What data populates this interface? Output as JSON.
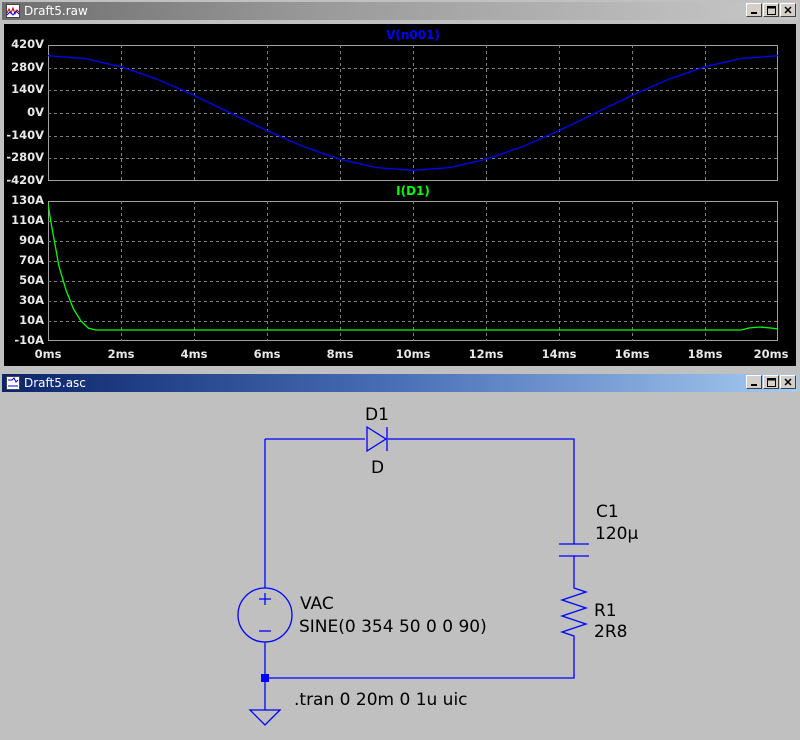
{
  "waveform_window": {
    "title": "Draft5.raw",
    "buttons": {
      "minimize": "_",
      "maximize": "□",
      "close": "×"
    }
  },
  "schematic_window": {
    "title": "Draft5.asc",
    "buttons": {
      "minimize": "_",
      "maximize": "□",
      "close": "×"
    }
  },
  "colors": {
    "voltage_trace": "#0000ff",
    "current_trace": "#00ff00",
    "plot_background": "#000000",
    "grid": "#808080",
    "wire": "#0000ff"
  },
  "chart_data": [
    {
      "type": "line",
      "title": "V(n001)",
      "x_unit": "ms",
      "x_range": [
        0,
        20
      ],
      "x_ticks": [
        "0ms",
        "2ms",
        "4ms",
        "6ms",
        "8ms",
        "10ms",
        "12ms",
        "14ms",
        "16ms",
        "18ms",
        "20ms"
      ],
      "y_range": [
        -420,
        420
      ],
      "y_ticks": [
        "420V",
        "280V",
        "140V",
        "0V",
        "-140V",
        "-280V",
        "-420V"
      ],
      "grid": true,
      "series": [
        {
          "name": "V(n001)",
          "color": "#0000ff",
          "x": [
            0,
            1,
            2,
            3,
            4,
            5,
            6,
            7,
            8,
            9,
            10,
            11,
            12,
            13,
            14,
            15,
            16,
            17,
            18,
            19,
            20
          ],
          "y": [
            354,
            337,
            286,
            208,
            109,
            0,
            -109,
            -208,
            -286,
            -337,
            -354,
            -337,
            -286,
            -208,
            -109,
            0,
            109,
            208,
            286,
            337,
            354
          ]
        }
      ]
    },
    {
      "type": "line",
      "title": "I(D1)",
      "x_unit": "ms",
      "x_range": [
        0,
        20
      ],
      "y_range": [
        -10,
        130
      ],
      "y_ticks": [
        "130A",
        "110A",
        "90A",
        "70A",
        "50A",
        "30A",
        "10A",
        "-10A"
      ],
      "grid": true,
      "series": [
        {
          "name": "I(D1)",
          "color": "#00ff00",
          "x": [
            0,
            0.1,
            0.2,
            0.3,
            0.5,
            0.7,
            0.9,
            1.1,
            1.3,
            2,
            4,
            6,
            8,
            10,
            12,
            14,
            16,
            18,
            19,
            19.2,
            19.5,
            19.8,
            20
          ],
          "y": [
            127,
            105,
            85,
            65,
            40,
            22,
            10,
            3,
            1,
            1,
            1,
            1,
            1,
            1,
            1,
            1,
            1,
            1,
            1,
            3,
            4,
            3,
            2
          ]
        }
      ]
    }
  ],
  "schematic": {
    "diode": {
      "ref": "D1",
      "model": "D"
    },
    "capacitor": {
      "ref": "C1",
      "value": "120µ"
    },
    "resistor": {
      "ref": "R1",
      "value": "2R8"
    },
    "source": {
      "ref": "VAC",
      "value": "SINE(0 354 50 0 0 90)"
    },
    "directive": ".tran 0 20m 0 1u uic"
  }
}
